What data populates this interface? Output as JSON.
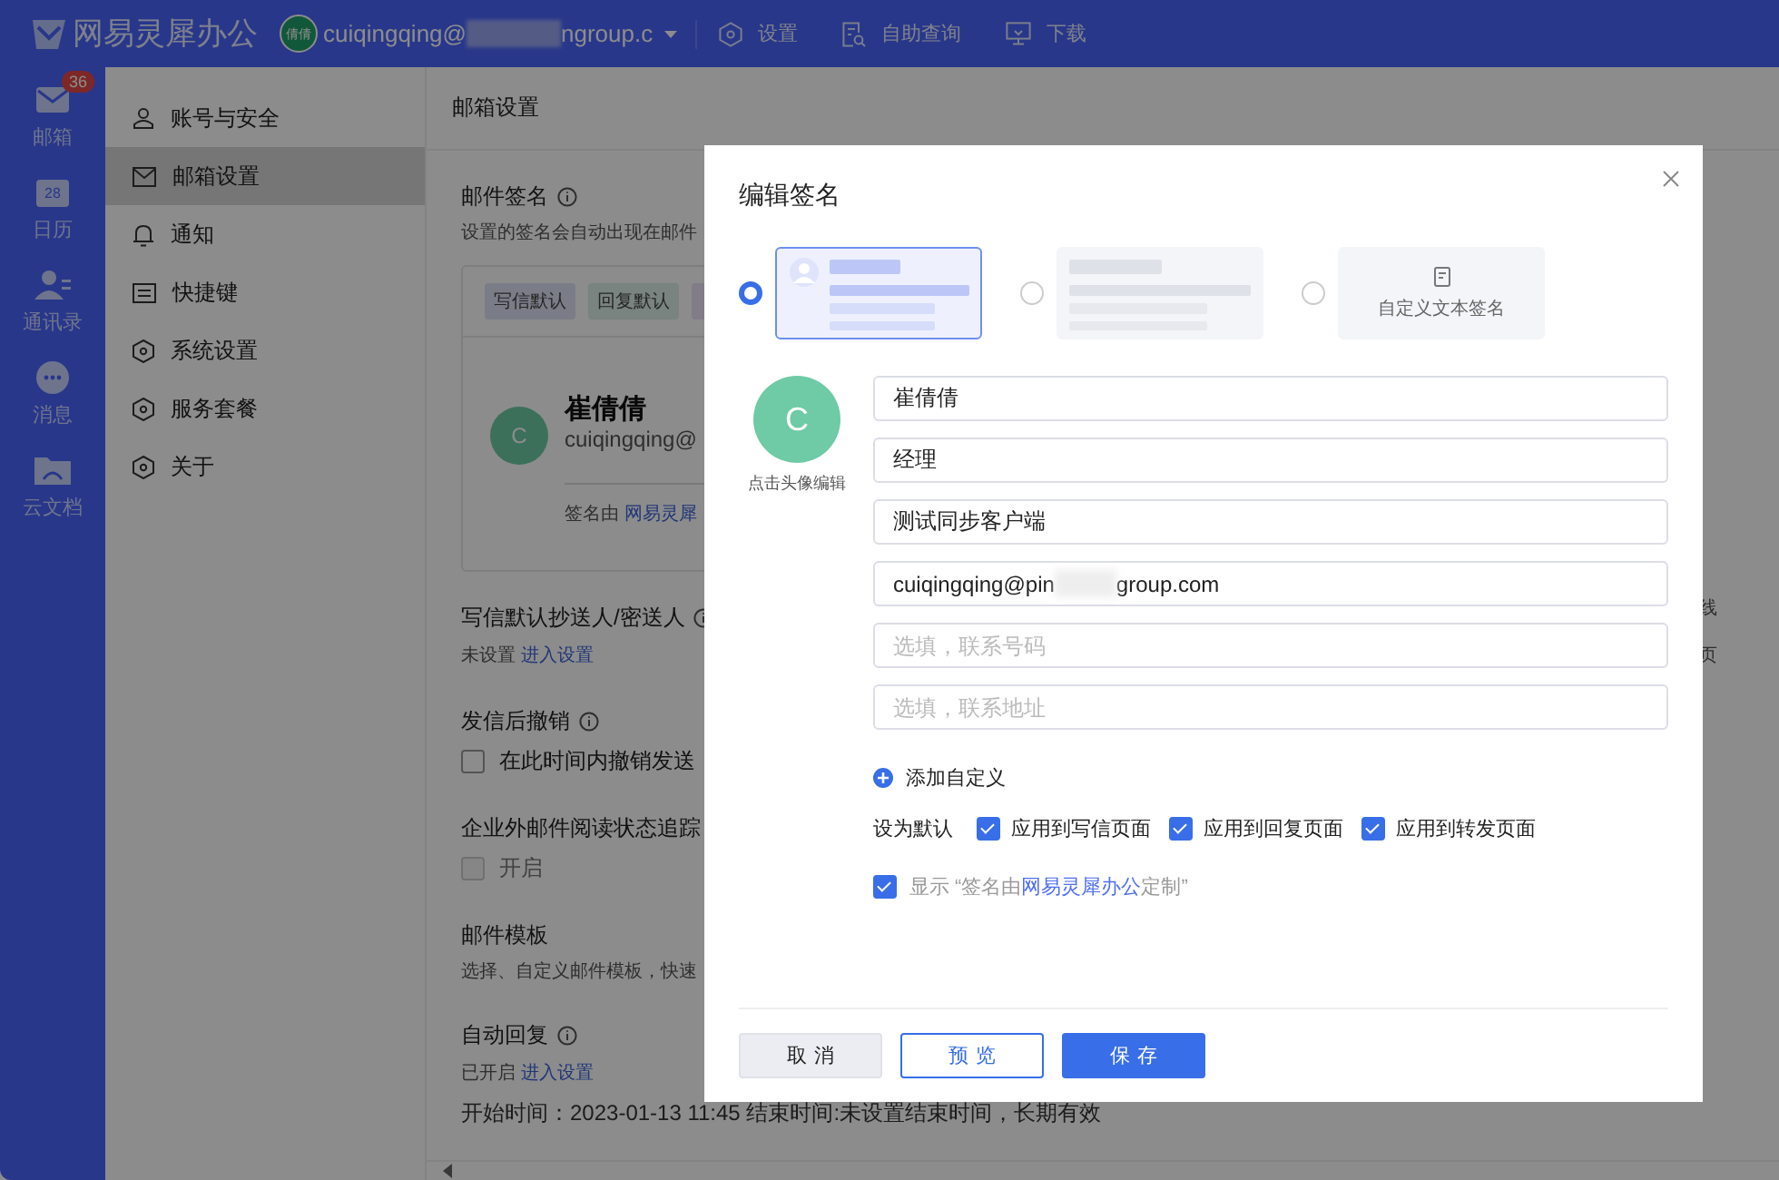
{
  "top_bar": {
    "logo": "网易灵犀办公",
    "avatar": "倩倩",
    "account_prefix": "cuiqingqing@",
    "account_suffix": "ngroup.c",
    "links": [
      {
        "kind": "settings",
        "label": "设置"
      },
      {
        "kind": "query",
        "label": "自助查询"
      },
      {
        "kind": "download",
        "label": "下载"
      }
    ]
  },
  "rail": [
    {
      "kind": "mail",
      "label": "邮箱",
      "badge": "36"
    },
    {
      "kind": "calendar",
      "label": "日历",
      "icon_text": "28"
    },
    {
      "kind": "contacts",
      "label": "通讯录"
    },
    {
      "kind": "message",
      "label": "消息"
    },
    {
      "kind": "docs",
      "label": "云文档"
    }
  ],
  "sidebar": [
    {
      "kind": "user",
      "label": "账号与安全",
      "selected": false
    },
    {
      "kind": "mail",
      "label": "邮箱设置",
      "selected": true
    },
    {
      "kind": "bell",
      "label": "通知",
      "selected": false
    },
    {
      "kind": "keyboard",
      "label": "快捷键",
      "selected": false
    },
    {
      "kind": "gear",
      "label": "系统设置",
      "selected": false
    },
    {
      "kind": "gear",
      "label": "服务套餐",
      "selected": false
    },
    {
      "kind": "gear",
      "label": "关于",
      "selected": false
    }
  ],
  "content": {
    "header": "邮箱设置",
    "blocks": [
      {
        "kind": "title",
        "text": "邮件签名",
        "info": true
      },
      {
        "kind": "note",
        "text": "设置的签名会自动出现在邮件"
      },
      {
        "kind": "card",
        "tags": [
          {
            "label": "写信默认",
            "color": "#7a7d87"
          },
          {
            "label": "回复默认",
            "color": "#798380"
          },
          {
            "color": "#817c88"
          }
        ],
        "avatar": "C",
        "name": "崔倩倩",
        "email": "cuiqingqing@",
        "footer_prefix": "签名由",
        "footer_link": "网易灵犀"
      },
      {
        "kind": "title",
        "text": "写信默认抄送人/密送人",
        "info": true
      },
      {
        "kind": "status",
        "text": "未设置",
        "link": "进入设置"
      },
      {
        "kind": "title",
        "text": "发信后撤销",
        "info": true
      },
      {
        "kind": "check",
        "label": "在此时间内撤销发送",
        "checked": false,
        "disabled": false
      },
      {
        "kind": "title",
        "text": "企业外邮件阅读状态追踪"
      },
      {
        "kind": "check",
        "label": "开启",
        "checked": false,
        "disabled": true
      },
      {
        "kind": "title",
        "text": "邮件模板",
        "info": false
      },
      {
        "kind": "note",
        "text": "选择、自定义邮件模板，快速"
      },
      {
        "kind": "title",
        "text": "自动回复",
        "info": true
      },
      {
        "kind": "status",
        "text": "已开启",
        "link": "进入设置"
      },
      {
        "kind": "plain",
        "text": "开始时间：2023-01-13 11:45    结束时间:未设置结束时间，长期有效"
      }
    ],
    "side_texts": [
      "线",
      "页"
    ]
  },
  "modal": {
    "title": "编辑签名",
    "templates": [
      {
        "kind": "card",
        "selected": true
      },
      {
        "kind": "plain",
        "selected": false
      },
      {
        "kind": "text",
        "label": "自定义文本签名",
        "selected": false
      }
    ],
    "avatar": "C",
    "avatar_hint": "点击头像编辑",
    "fields": [
      {
        "kind": "text",
        "value": "崔倩倩"
      },
      {
        "kind": "text",
        "value": "经理"
      },
      {
        "kind": "text",
        "value": "测试同步客户端"
      },
      {
        "kind": "redacted",
        "parts": [
          "cuiqingqing@pin",
          "group.com"
        ]
      },
      {
        "kind": "text",
        "placeholder": "选填，联系号码"
      },
      {
        "kind": "text",
        "placeholder": "选填，联系地址"
      }
    ],
    "add_custom": "添加自定义",
    "default_label": "设为默认",
    "defaults": [
      {
        "label": "应用到写信页面",
        "checked": true
      },
      {
        "label": "应用到回复页面",
        "checked": true
      },
      {
        "label": "应用到转发页面",
        "checked": true
      }
    ],
    "branding": {
      "checked": true,
      "prefix": "显示 “签名由",
      "link": "网易灵犀办公",
      "suffix": "定制”"
    },
    "buttons": [
      {
        "kind": "secondary",
        "label": "取消"
      },
      {
        "kind": "outline",
        "label": "预览"
      },
      {
        "kind": "primary",
        "label": "保存"
      }
    ]
  }
}
